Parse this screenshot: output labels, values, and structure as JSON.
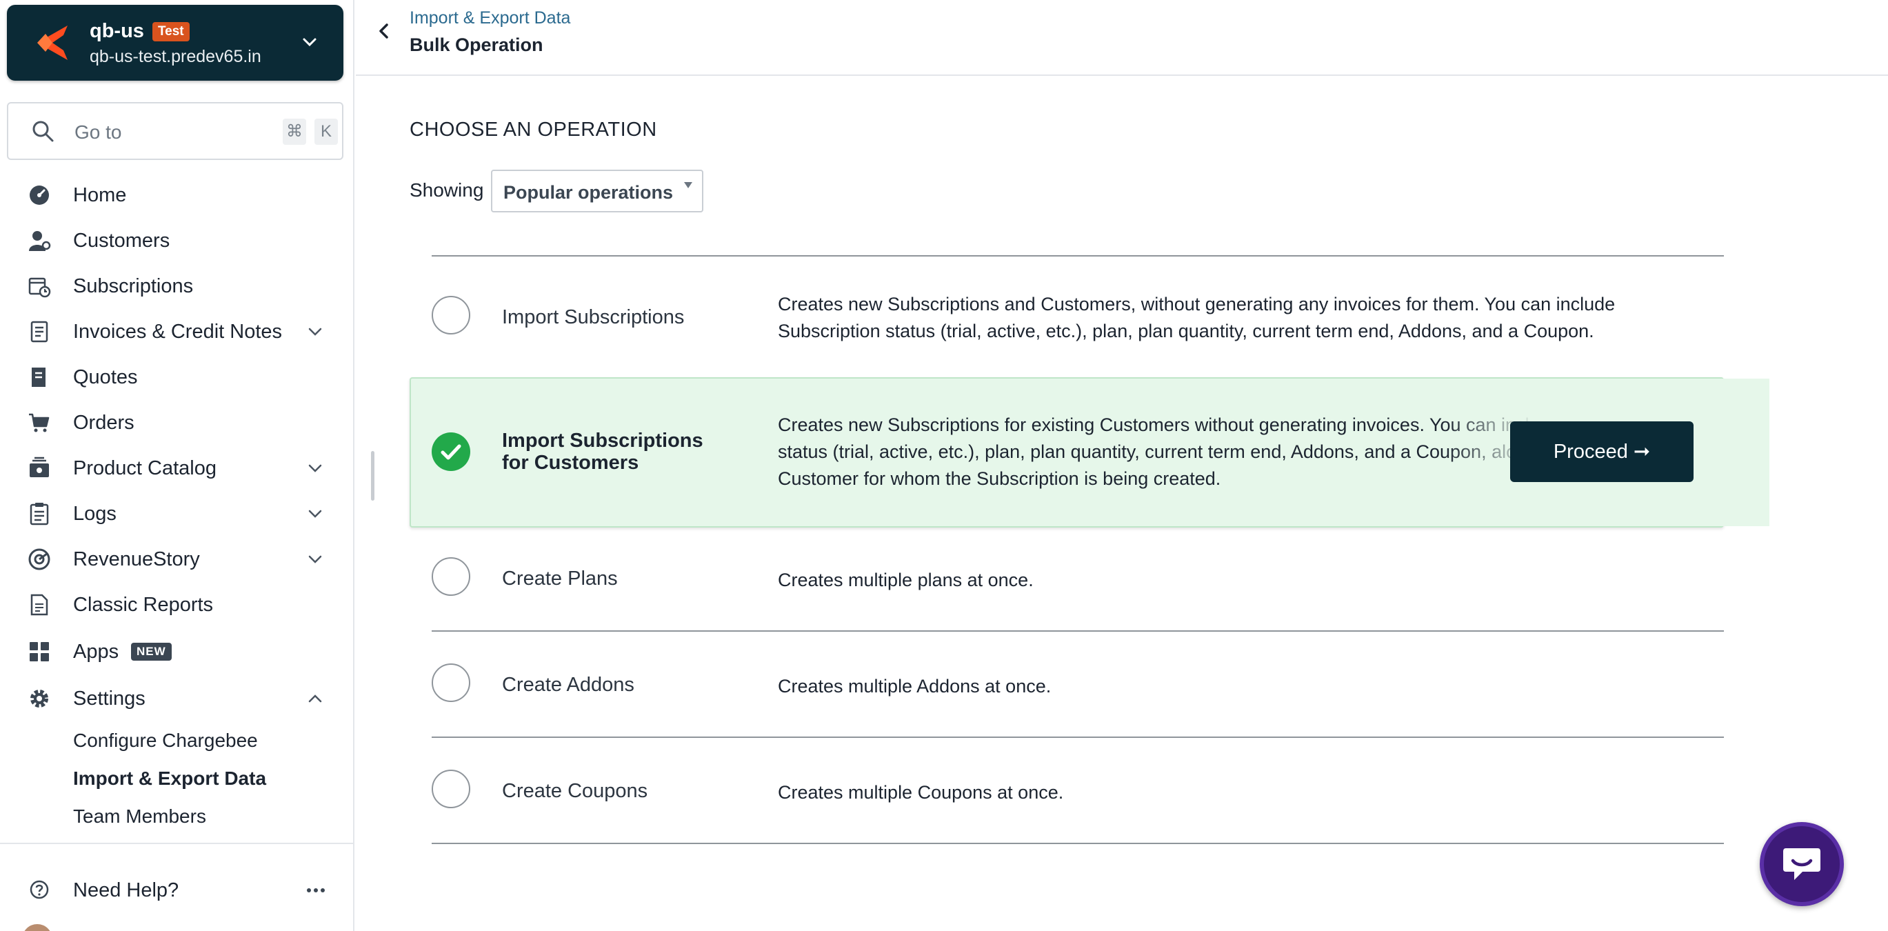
{
  "site": {
    "name": "qb-us",
    "badge": "Test",
    "domain": "qb-us-test.predev65.in"
  },
  "goto": {
    "placeholder": "Go to",
    "shortcut_cmd": "⌘",
    "shortcut_key": "K"
  },
  "nav": {
    "items": [
      {
        "label": "Home",
        "icon": "home-dashboard-icon"
      },
      {
        "label": "Customers",
        "icon": "customers-icon"
      },
      {
        "label": "Subscriptions",
        "icon": "subscriptions-icon"
      },
      {
        "label": "Invoices & Credit Notes",
        "icon": "invoice-icon"
      },
      {
        "label": "Quotes",
        "icon": "quotes-icon"
      },
      {
        "label": "Orders",
        "icon": "cart-icon"
      },
      {
        "label": "Product Catalog",
        "icon": "catalog-icon"
      },
      {
        "label": "Logs",
        "icon": "logs-icon"
      },
      {
        "label": "RevenueStory",
        "icon": "revenuestory-icon"
      },
      {
        "label": "Classic Reports",
        "icon": "reports-icon"
      },
      {
        "label": "Apps",
        "icon": "apps-grid-icon",
        "badge": "NEW"
      },
      {
        "label": "Settings",
        "icon": "gear-icon"
      }
    ],
    "settings_sub": [
      "Configure Chargebee",
      "Import & Export Data",
      "Team Members"
    ],
    "help": "Need Help?"
  },
  "header": {
    "breadcrumb": "Import & Export Data",
    "title": "Bulk Operation"
  },
  "main": {
    "section_title": "CHOOSE AN OPERATION",
    "showing_label": "Showing",
    "filter_value": "Popular operations",
    "proceed_label": "Proceed ➞",
    "operations": [
      {
        "name": "Import Subscriptions",
        "description": "Creates new Subscriptions and Customers, without generating any invoices for them. You can include Subscription status (trial, active, etc.), plan, plan quantity, current term end, Addons, and a Coupon."
      },
      {
        "name_line1": "Import Subscriptions",
        "name_line2": "for Customers",
        "description": "Creates new Subscriptions for existing Customers without generating invoices. You can include Subscription status (trial, active, etc.), plan, plan quantity, current term end, Addons, and a Coupon, along with the Customer for whom the Subscription is being created.",
        "selected": true
      },
      {
        "name": "Create Plans",
        "description": "Creates multiple plans at once."
      },
      {
        "name": "Create Addons",
        "description": "Creates multiple Addons at once."
      },
      {
        "name": "Create Coupons",
        "description": "Creates multiple Coupons at once."
      }
    ]
  },
  "colors": {
    "brand_dark": "#0b2a36",
    "accent_orange": "#d9531e",
    "selected_bg": "#e6f7ea",
    "success_green": "#22a94a",
    "chat_purple": "#3d1a78"
  }
}
